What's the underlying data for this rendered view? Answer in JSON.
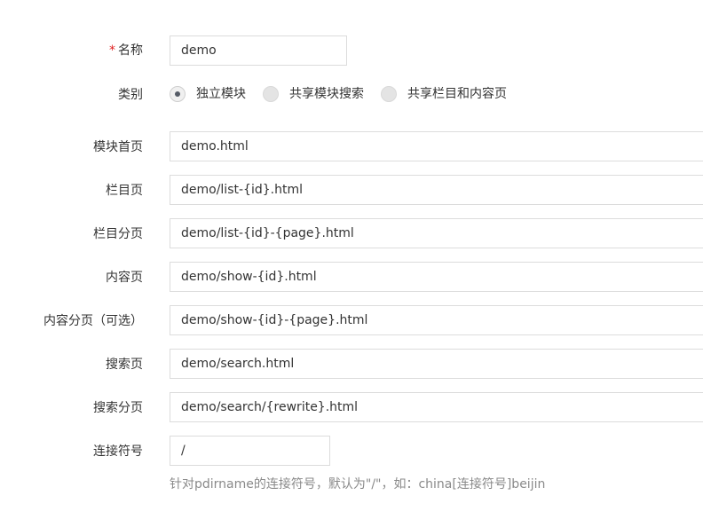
{
  "fields": {
    "name": {
      "label": "名称",
      "required_mark": "*",
      "value": "demo"
    },
    "category": {
      "label": "类别",
      "options": [
        "独立模块",
        "共享模块搜索",
        "共享栏目和内容页"
      ],
      "selected": "独立模块"
    },
    "module_home": {
      "label": "模块首页",
      "value": "demo.html"
    },
    "list_page": {
      "label": "栏目页",
      "value": "demo/list-{id}.html"
    },
    "list_paging": {
      "label": "栏目分页",
      "value": "demo/list-{id}-{page}.html"
    },
    "content_page": {
      "label": "内容页",
      "value": "demo/show-{id}.html"
    },
    "content_paging": {
      "label": "内容分页（可选）",
      "value": "demo/show-{id}-{page}.html"
    },
    "search_page": {
      "label": "搜索页",
      "value": "demo/search.html"
    },
    "search_paging": {
      "label": "搜索分页",
      "value": "demo/search/{rewrite}.html"
    },
    "connector": {
      "label": "连接符号",
      "value": "/",
      "help": "针对pdirname的连接符号，默认为\"/\"，如：china[连接符号]beijin"
    }
  },
  "colors": {
    "required": "#e02020",
    "border": "#dcdcdc",
    "help_text": "#8a8a8a",
    "radio_dot": "#555b66"
  }
}
